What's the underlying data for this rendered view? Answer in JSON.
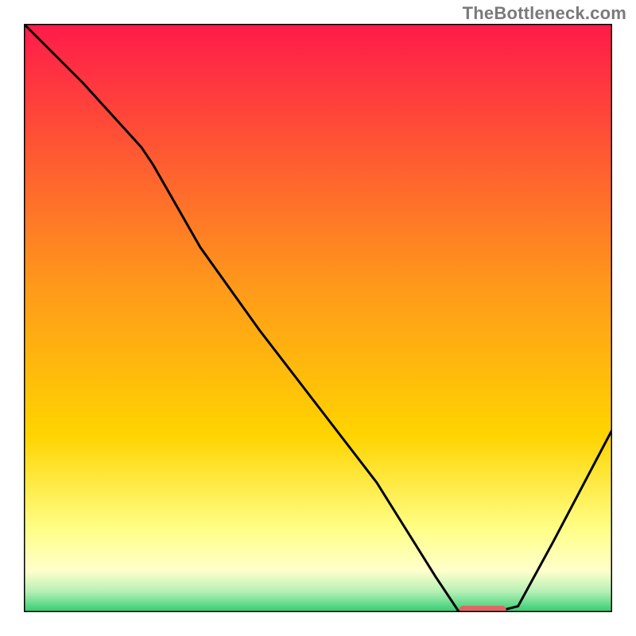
{
  "watermark": "TheBottleneck.com",
  "chart_data": {
    "type": "line",
    "title": "",
    "xlabel": "",
    "ylabel": "",
    "xlim": [
      0,
      100
    ],
    "ylim": [
      0,
      100
    ],
    "grid": false,
    "series": [
      {
        "name": "bottleneck-curve",
        "x": [
          0,
          10,
          20,
          22,
          30,
          40,
          50,
          60,
          70,
          74,
          76,
          80,
          84,
          90,
          100
        ],
        "y": [
          100,
          90,
          79,
          76,
          62,
          48,
          35,
          22,
          6,
          0,
          0,
          0,
          1,
          12,
          31
        ]
      }
    ],
    "marker": {
      "name": "optimal-range",
      "x_start": 74,
      "x_end": 82,
      "y": 0,
      "color": "#e06666"
    },
    "background_gradient": {
      "top": "#ff1a4a",
      "mid": "#ffd400",
      "lower": "#ffff88",
      "bottom": "#2ecc71"
    }
  }
}
